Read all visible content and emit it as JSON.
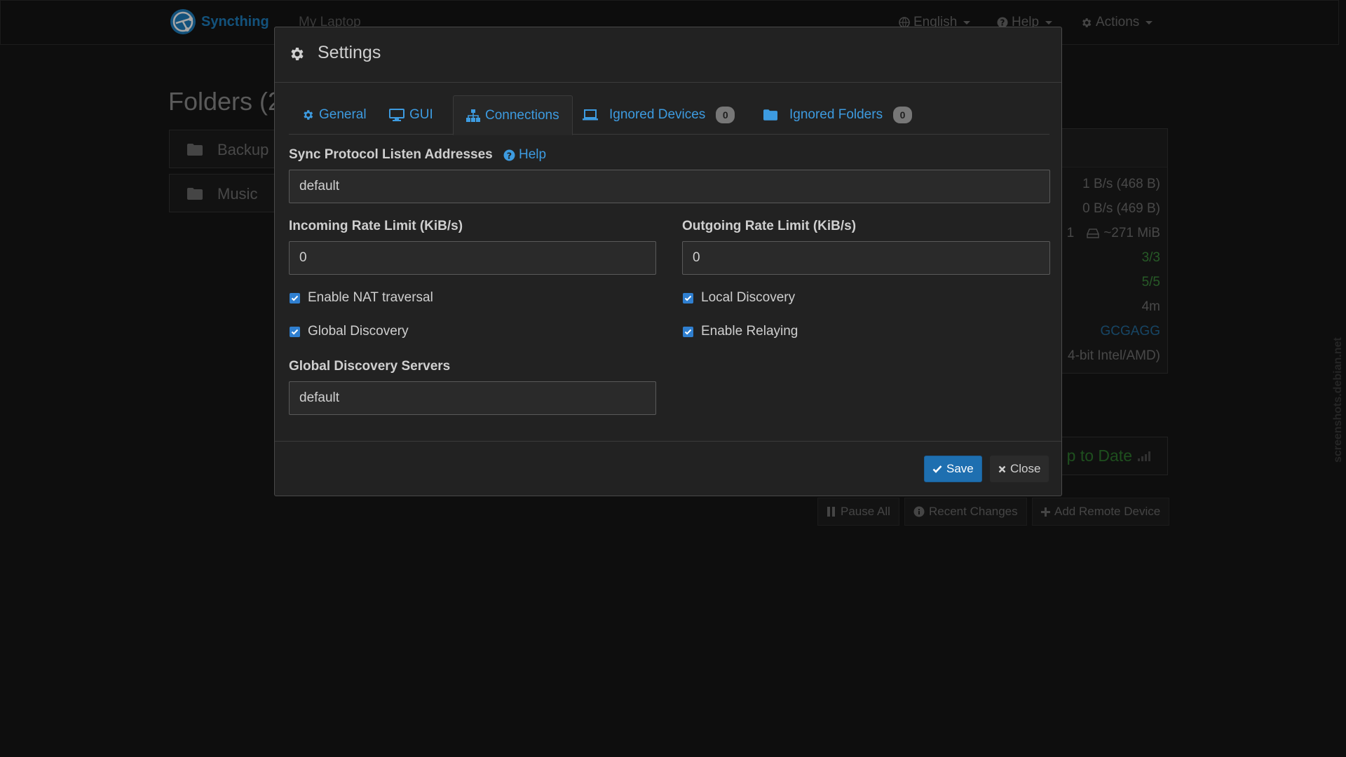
{
  "navbar": {
    "brand": "Syncthing",
    "device_name": "My Laptop",
    "language_label": "English",
    "help_label": "Help",
    "actions_label": "Actions"
  },
  "background": {
    "folders_title": "Folders (2",
    "folders": [
      {
        "name": "Backup"
      },
      {
        "name": "Music"
      }
    ],
    "device_stats": {
      "download_rate": "1 B/s (468 B)",
      "upload_rate": "0 B/s (469 B)",
      "local_state_count": "1",
      "local_state_size": "~271 MiB",
      "listeners": "3/3",
      "discovery": "5/5",
      "uptime": "4m",
      "device_id": "GCGAGG",
      "version": "4-bit Intel/AMD)"
    },
    "remote_status": "p to Date",
    "buttons": {
      "pause_all": "Pause All",
      "recent_changes": "Recent Changes",
      "add_remote_device": "Add Remote Device"
    },
    "watermark": "screenshots.debian.net"
  },
  "modal": {
    "title": "Settings",
    "tabs": [
      {
        "label": "General"
      },
      {
        "label": "GUI"
      },
      {
        "label": "Connections"
      },
      {
        "label": "Ignored Devices",
        "badge": "0"
      },
      {
        "label": "Ignored Folders",
        "badge": "0"
      }
    ],
    "listen_addresses": {
      "label": "Sync Protocol Listen Addresses",
      "help": "Help",
      "value": "default"
    },
    "incoming_rate": {
      "label": "Incoming Rate Limit (KiB/s)",
      "value": "0"
    },
    "outgoing_rate": {
      "label": "Outgoing Rate Limit (KiB/s)",
      "value": "0"
    },
    "checkboxes": {
      "nat_traversal": "Enable NAT traversal",
      "local_discovery": "Local Discovery",
      "global_discovery": "Global Discovery",
      "relaying": "Enable Relaying"
    },
    "discovery_servers": {
      "label": "Global Discovery Servers",
      "value": "default"
    },
    "save_label": "Save",
    "close_label": "Close"
  },
  "colors": {
    "accent": "#3d9be0",
    "primary_button": "#1e6fb0",
    "checkbox": "#2f7fd0",
    "background": "#161616",
    "modal": "#222222"
  }
}
